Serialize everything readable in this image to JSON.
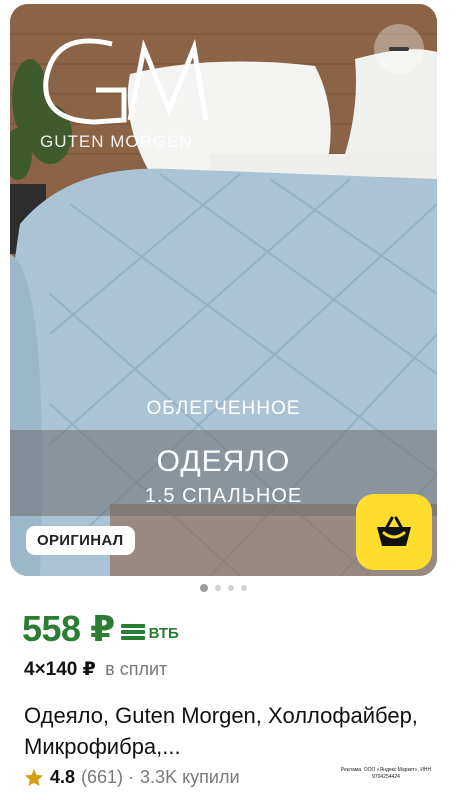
{
  "product_image": {
    "brand_monogram": "GM",
    "brand_name": "GUTEN MORGEN",
    "promo_top": "ОБЛЕГЧЕННОЕ",
    "promo_main": "ОДЕЯЛО",
    "promo_sub": "1.5 СПАЛЬНОЕ",
    "badge": "ОРИГИНАЛ",
    "carousel_total": 4,
    "carousel_active": 1
  },
  "price": {
    "current": "558 ₽",
    "bank": "ВТБ",
    "split_price": "4×140 ₽",
    "split_label": "в сплит"
  },
  "title": "Одеяло, Guten Morgen, Холлофайбер, Микрофибра,...",
  "rating": {
    "value": "4.8",
    "reviews": "(661) ·",
    "bought": "3.3K купили"
  },
  "ad_note": "Реклама. ООО «Яндекс Маркет», ИНН 9704254424",
  "icons": {
    "minus": "minus-icon",
    "cart": "basket-icon",
    "star": "star-icon",
    "bank": "vtb-icon"
  },
  "colors": {
    "price_green": "#2a7d32",
    "cart_yellow": "#ffdd2d",
    "star": "#d4a017"
  }
}
